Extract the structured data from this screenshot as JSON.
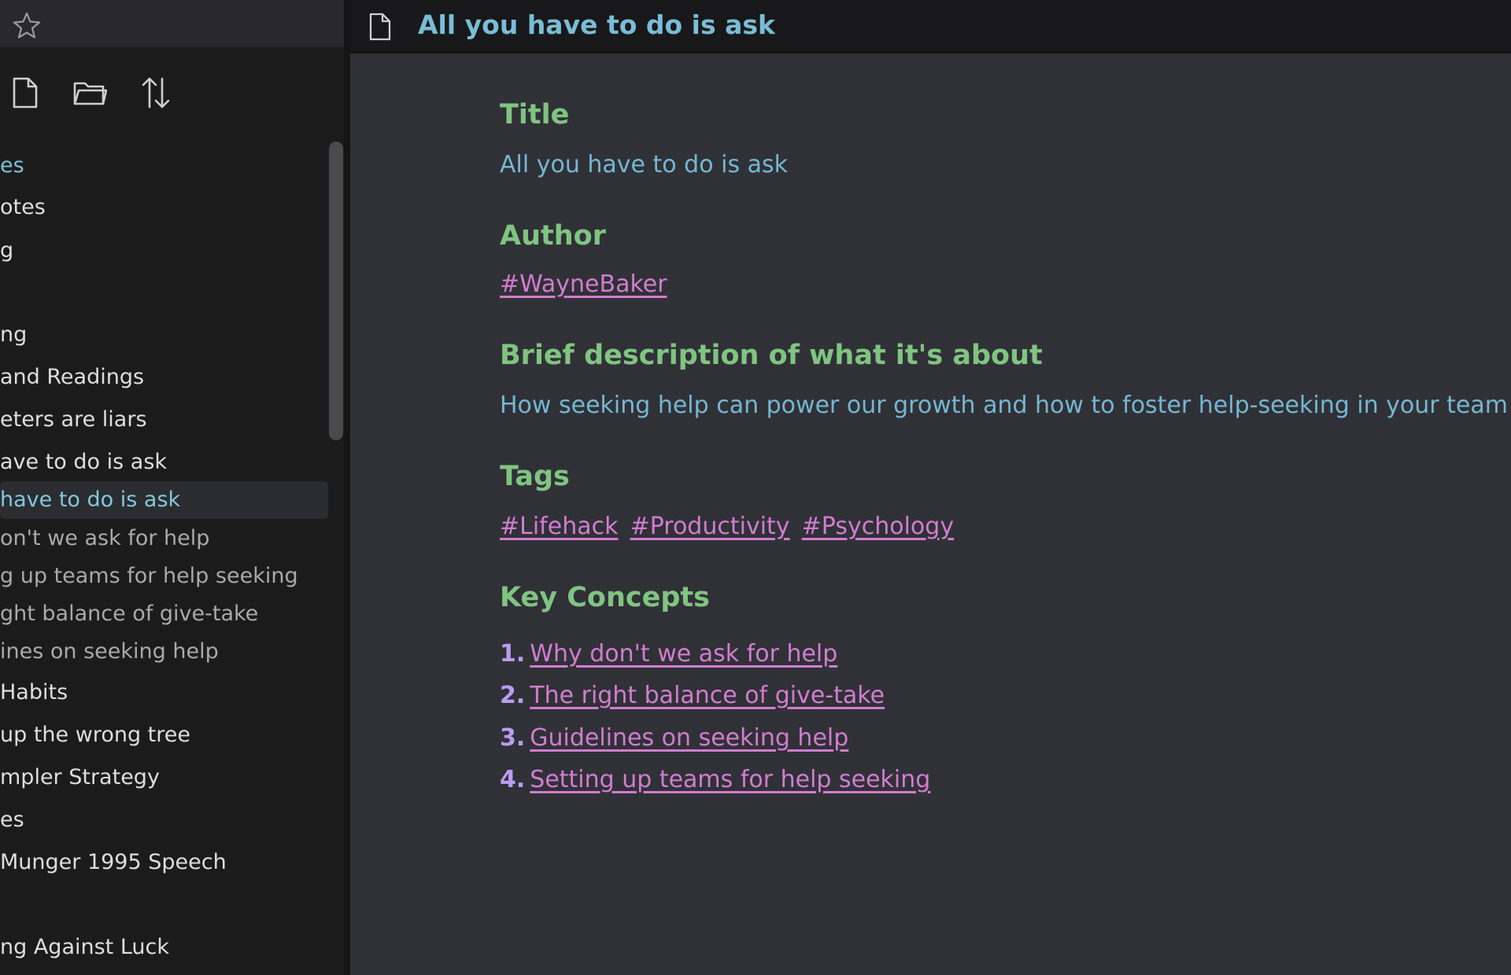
{
  "sidebar": {
    "items": [
      {
        "label": "es",
        "style": "accent"
      },
      {
        "label": "otes",
        "style": "folder"
      },
      {
        "label": "g",
        "style": "folder"
      },
      {
        "label": "ng",
        "style": "folder"
      },
      {
        "label": "and Readings",
        "style": "folder"
      },
      {
        "label": "eters are liars",
        "style": "folder"
      },
      {
        "label": "ave to do is ask",
        "style": "folder"
      },
      {
        "label": " have to do is ask",
        "style": "selected"
      },
      {
        "label": "on't we ask for help",
        "style": "child"
      },
      {
        "label": "g up teams for help seeking",
        "style": "child"
      },
      {
        "label": "ght balance of give-take",
        "style": "child"
      },
      {
        "label": "ines on seeking help",
        "style": "child"
      },
      {
        "label": "Habits",
        "style": "folder"
      },
      {
        "label": "up the wrong tree",
        "style": "folder"
      },
      {
        "label": "mpler Strategy",
        "style": "folder"
      },
      {
        "label": "es",
        "style": "folder"
      },
      {
        "label": "Munger 1995 Speech",
        "style": "folder"
      },
      {
        "label": "ng Against Luck",
        "style": "folder"
      }
    ]
  },
  "header": {
    "title": "All you have to do is ask"
  },
  "note": {
    "title_heading": "Title",
    "title_value": "All you have to do is ask",
    "author_heading": "Author",
    "author_value": "#WayneBaker",
    "description_heading": "Brief description of what it's about",
    "description_value": "How seeking help can power our growth and how to foster help-seeking in your team",
    "tags_heading": "Tags",
    "tags": [
      "#Lifehack",
      "#Productivity",
      "#Psychology"
    ],
    "concepts_heading": "Key Concepts",
    "concepts": [
      {
        "num": "1.",
        "label": "Why don't we ask for help"
      },
      {
        "num": "2.",
        "label": "The right balance of give-take"
      },
      {
        "num": "3.",
        "label": "Guidelines on seeking help"
      },
      {
        "num": "4.",
        "label": "Setting up teams for help seeking"
      }
    ]
  },
  "icons": {
    "star": "star-icon",
    "new_note": "new-note-icon",
    "new_folder": "new-folder-icon",
    "sort": "sort-icon",
    "document": "document-icon"
  },
  "colors": {
    "heading": "#80c481",
    "text": "#75b7d2",
    "link": "#d27ccf",
    "number": "#b99cf0"
  }
}
